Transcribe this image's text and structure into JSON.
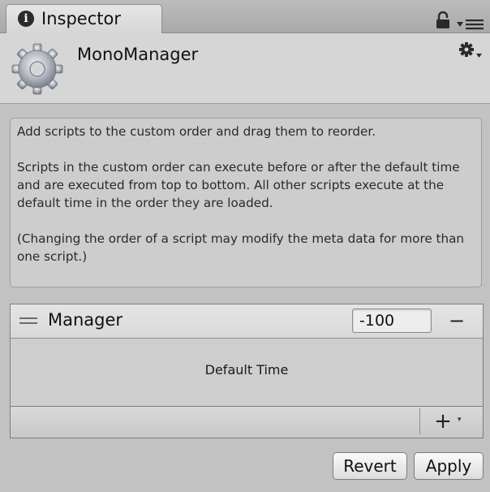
{
  "window": {
    "tab_label": "Inspector",
    "tab_icon": "info-icon"
  },
  "header": {
    "component_title": "MonoManager",
    "component_icon": "gear-icon"
  },
  "help": {
    "paragraphs": [
      "Add scripts to the custom order and drag them to reorder.",
      "Scripts in the custom order can execute before or after the default time and are executed from top to bottom. All other scripts execute at the default time in the order they are loaded.",
      "(Changing the order of a script may modify the meta data for more than one script.)"
    ]
  },
  "script_list": {
    "items": [
      {
        "name": "Manager",
        "order": "-100",
        "remove_label": "−"
      }
    ],
    "default_time_label": "Default Time",
    "add_label": "+",
    "add_dropdown_label": "▾"
  },
  "actions": {
    "revert_label": "Revert",
    "apply_label": "Apply"
  }
}
